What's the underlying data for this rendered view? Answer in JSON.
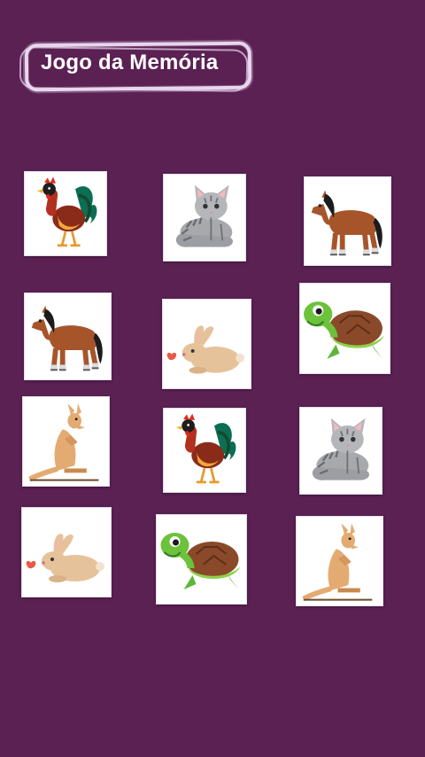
{
  "header": {
    "title": "Jogo da Memória"
  },
  "cards": [
    {
      "animal": "rooster-icon"
    },
    {
      "animal": "cat-icon"
    },
    {
      "animal": "horse-icon"
    },
    {
      "animal": "horse-icon"
    },
    {
      "animal": "rabbit-icon"
    },
    {
      "animal": "turtle-icon"
    },
    {
      "animal": "kangaroo-icon"
    },
    {
      "animal": "rooster-icon"
    },
    {
      "animal": "cat-icon"
    },
    {
      "animal": "rabbit-icon"
    },
    {
      "animal": "turtle-icon"
    },
    {
      "animal": "kangaroo-icon"
    }
  ],
  "colors": {
    "background": "#5b2153",
    "card": "#ffffff",
    "title_border": "#e8d6f0"
  }
}
